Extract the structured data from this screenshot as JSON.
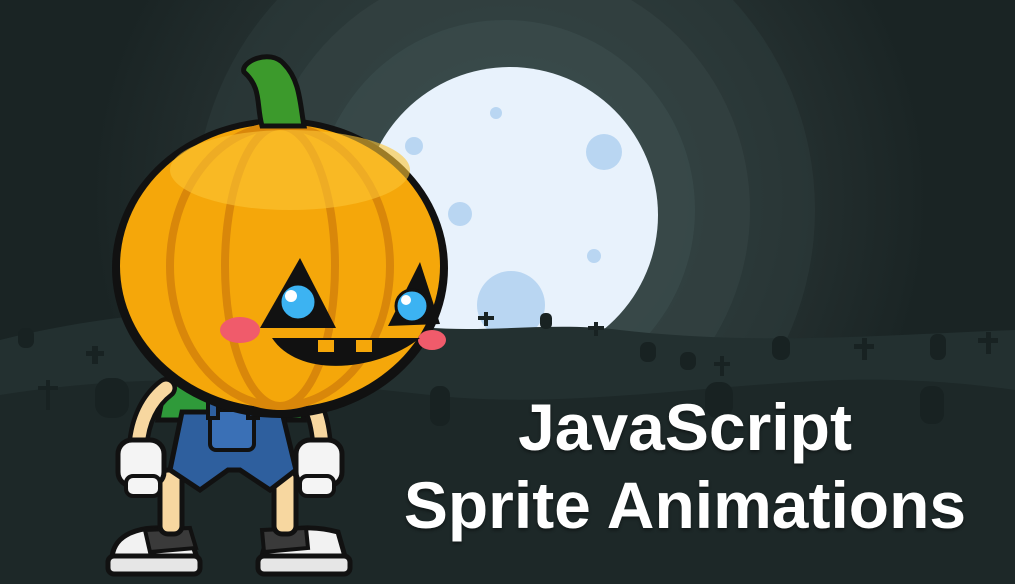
{
  "banner": {
    "title_line1": "JavaScript",
    "title_line2": "Sprite Animations"
  },
  "scene": {
    "background": "graveyard-night",
    "moon": "full-moon",
    "character": "pumpkin-head-boy"
  },
  "colors": {
    "sky": "#1c2626",
    "moon": "#e8f2fc",
    "pumpkin": "#f5a70a",
    "stem": "#3c9a2c",
    "shirt": "#2f9a3a",
    "overalls": "#2e5f9e",
    "title_text": "#ffffff"
  }
}
